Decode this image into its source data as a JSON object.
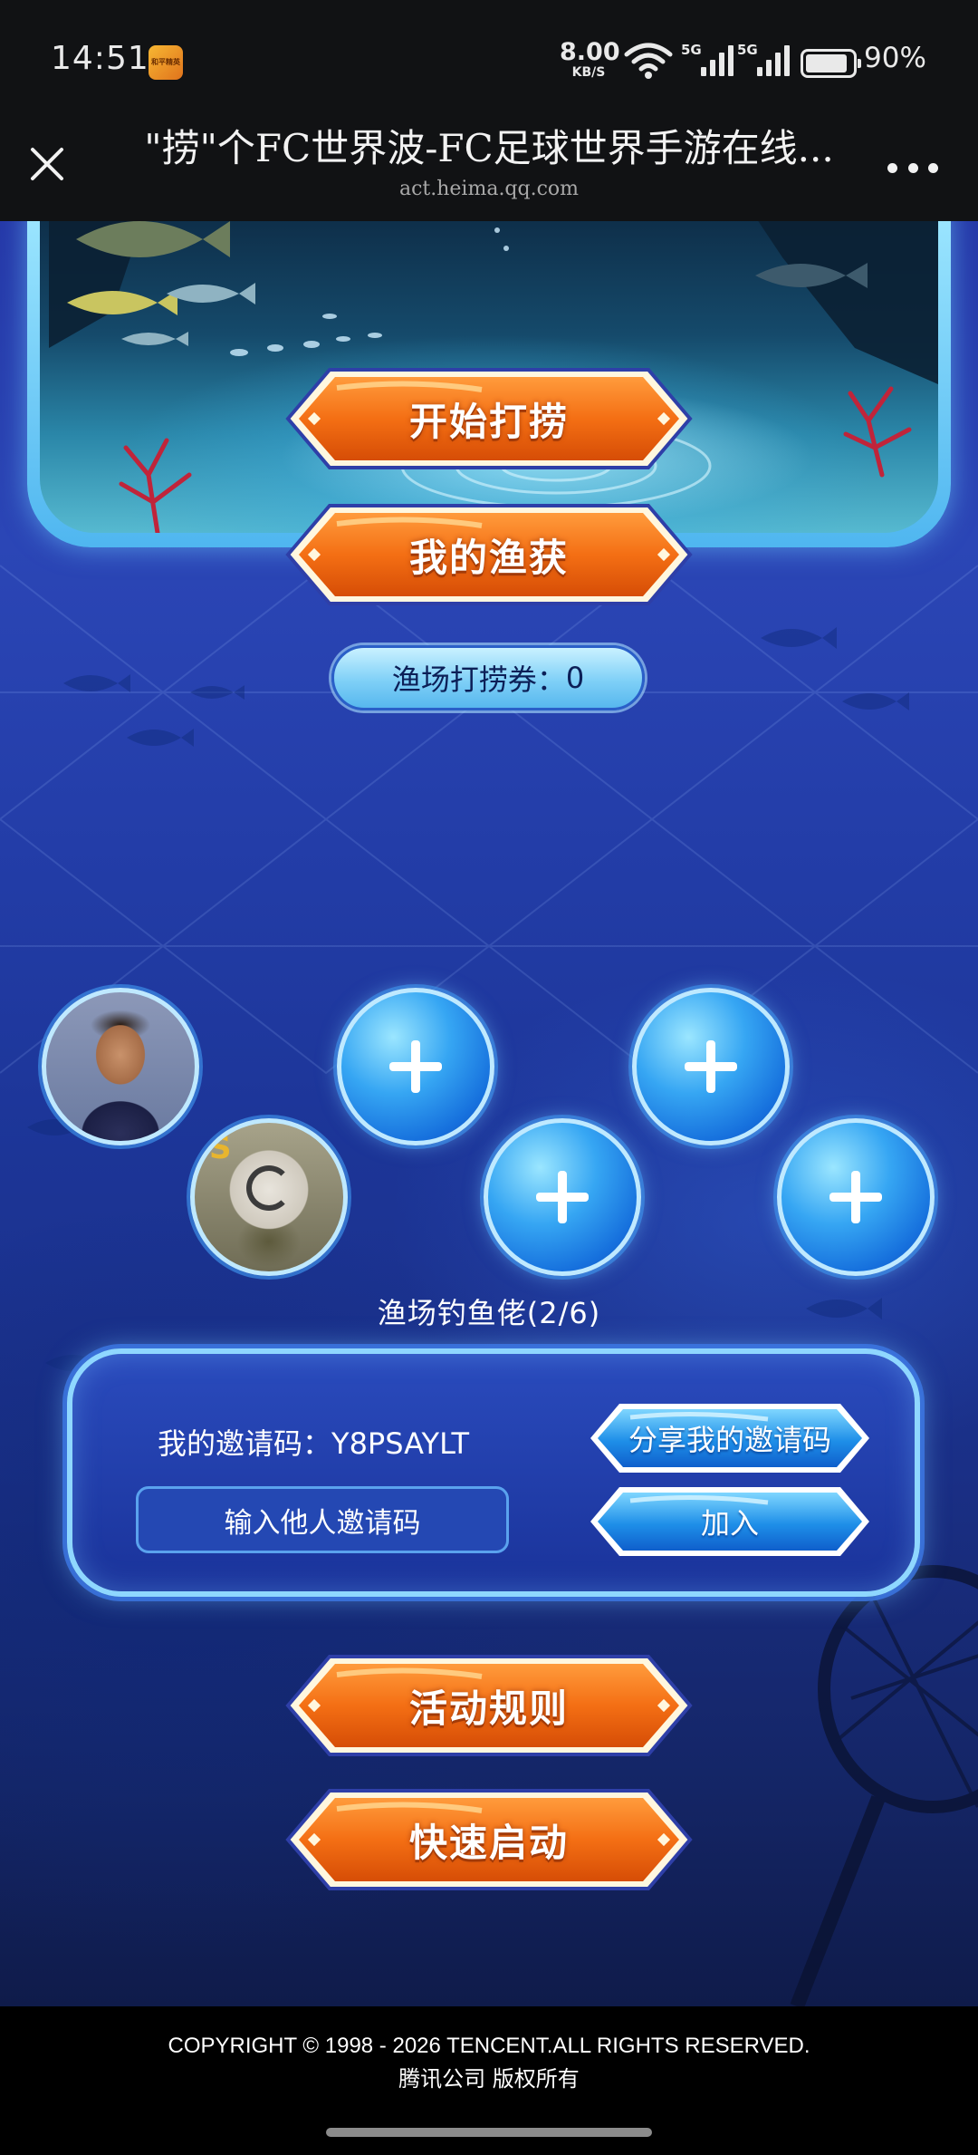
{
  "status_bar": {
    "time": "14:51",
    "app_badge": "和平精英",
    "net_speed": "8.00",
    "net_unit": "KB/S",
    "signal_1": "5G",
    "signal_2": "5G",
    "battery": "90%",
    "battery_level": 0.9
  },
  "titlebar": {
    "title": "\"捞\"个FC世界波-FC足球世界手游在线...",
    "url": "act.heima.qq.com"
  },
  "actions": {
    "start": "开始打捞",
    "catch": "我的渔获"
  },
  "ticket": {
    "label": "渔场打捞券：",
    "count": "0"
  },
  "squad": {
    "label": "渔场钓鱼佬(2/6)",
    "members": [
      "avatar",
      "avatar",
      "empty",
      "empty",
      "empty",
      "empty"
    ]
  },
  "invite": {
    "code_label": "我的邀请码：",
    "code": "Y8PSAYLT",
    "share_label": "分享我的邀请码",
    "input_placeholder": "输入他人邀请码",
    "join_label": "加入"
  },
  "bottom_actions": {
    "rules": "活动规则",
    "quick": "快速启动"
  },
  "footer": {
    "copyright": "COPYRIGHT © 1998 - 2026 TENCENT.ALL RIGHTS RESERVED.",
    "company": "腾讯公司 版权所有"
  },
  "colors": {
    "page_bg": "#2538a8",
    "button_orange": "#f46f14",
    "button_blue": "#1e8fe8",
    "panel_border": "#8fd7ff"
  }
}
